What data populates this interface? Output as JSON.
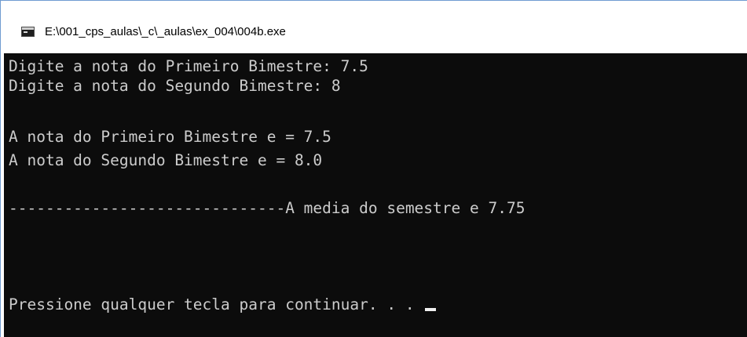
{
  "window": {
    "title": "E:\\001_cps_aulas\\_c\\_aulas\\ex_004\\004b.exe",
    "icon": "console-app-icon"
  },
  "console": {
    "lines": [
      "Digite a nota do Primeiro Bimestre: 7.5",
      "Digite a nota do Segundo Bimestre: 8",
      "A nota do Primeiro Bimestre e = 7.5",
      "A nota do Segundo Bimestre e = 8.0",
      "------------------------------A media do semestre e 7.75",
      "Pressione qualquer tecla para continuar. . . "
    ],
    "colors": {
      "background": "#0c0c0c",
      "text": "#cccccc",
      "cursor": "#f0f0f0"
    }
  }
}
